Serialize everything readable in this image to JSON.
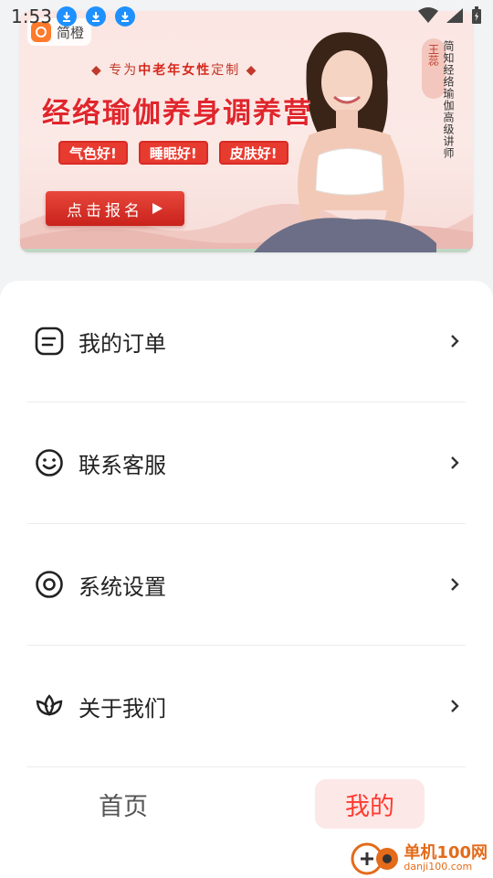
{
  "status_bar": {
    "time": "1:53",
    "download_icons": [
      "download-icon",
      "download-icon",
      "download-icon"
    ],
    "system_icons": [
      "wifi-icon",
      "signal-icon",
      "battery-icon"
    ]
  },
  "banner": {
    "brand_name": "简橙",
    "tagline_prefix": "◆ 专为",
    "tagline_highlight": "中老年女性",
    "tagline_suffix": "定制 ◆",
    "headline": "经络瑜伽养身调养营",
    "benefits": [
      "气色好!",
      "睡眠好!",
      "皮肤好!"
    ],
    "cta_label": "点击报名",
    "instructor_name": "王蕊",
    "instructor_title": "简知经络瑜伽高级讲师",
    "accent_color": "#e0262c"
  },
  "menu": {
    "items": [
      {
        "label": "我的订单",
        "icon": "order-icon"
      },
      {
        "label": "联系客服",
        "icon": "smiley-icon"
      },
      {
        "label": "系统设置",
        "icon": "settings-icon"
      },
      {
        "label": "关于我们",
        "icon": "lotus-icon"
      }
    ]
  },
  "tab_bar": {
    "tabs": [
      {
        "label": "首页",
        "active": false
      },
      {
        "label": "我的",
        "active": true
      }
    ],
    "active_color": "#ff3b30"
  },
  "watermark": {
    "name": "单机100网",
    "url": "danji100.com"
  }
}
